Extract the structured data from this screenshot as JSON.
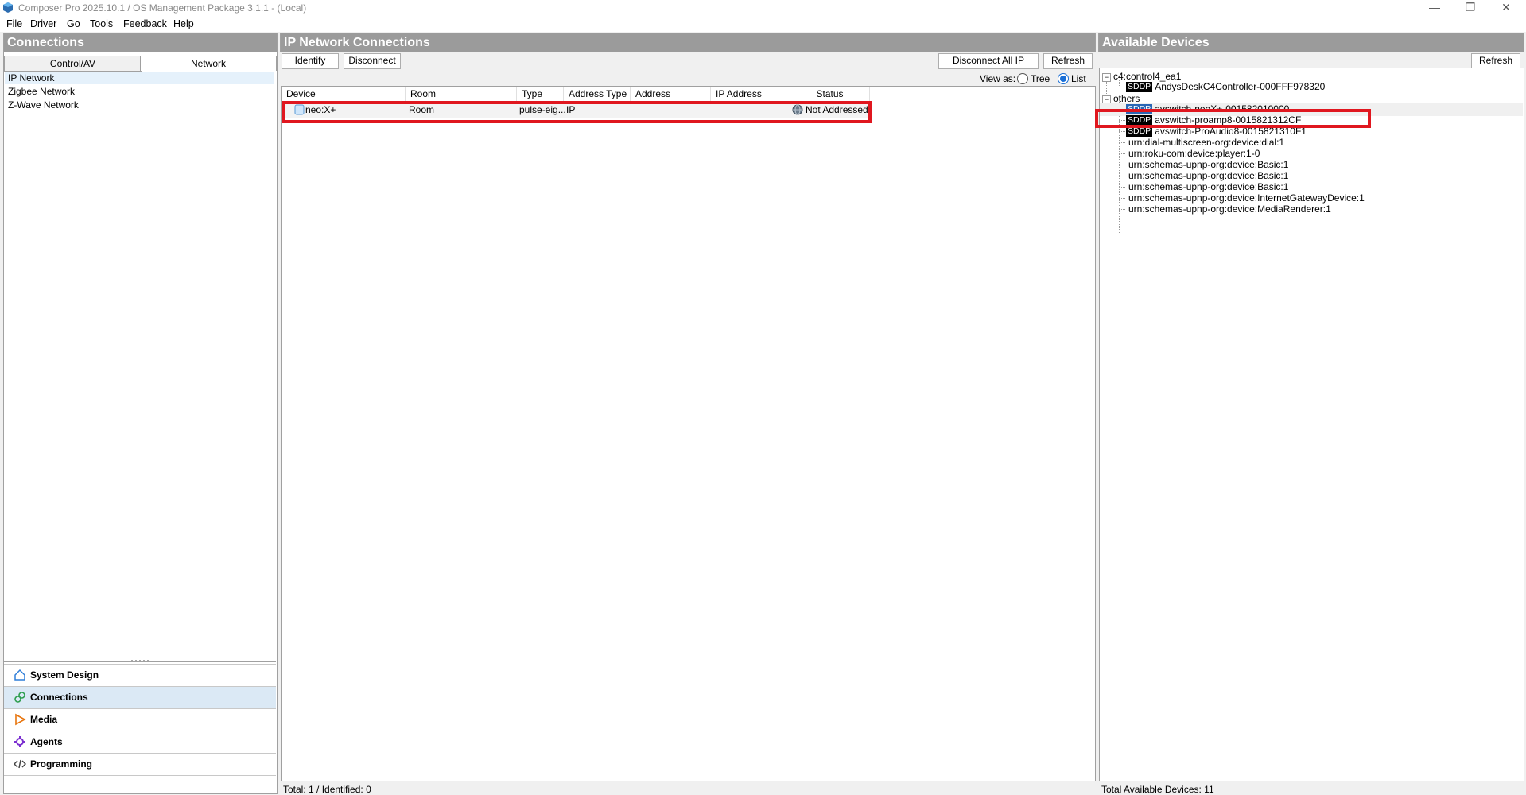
{
  "window": {
    "title": "Composer Pro 2025.10.1 / OS Management Package 3.1.1 - (Local)",
    "minimize": "—",
    "maximize": "❐",
    "close": "✕"
  },
  "menu": {
    "items": [
      "File",
      "Driver",
      "Go",
      "Tools",
      "Feedback",
      "Help"
    ]
  },
  "connections": {
    "header": "Connections",
    "tabs": [
      "Control/AV",
      "Network"
    ],
    "active_tab": "Network",
    "network_items": [
      "IP Network",
      "Zigbee Network",
      "Z-Wave Network"
    ],
    "selected_item": "IP Network",
    "splitter": "........."
  },
  "nav": {
    "items": [
      {
        "label": "System Design",
        "icon": "house-icon"
      },
      {
        "label": "Connections",
        "icon": "link-icon"
      },
      {
        "label": "Media",
        "icon": "play-icon"
      },
      {
        "label": "Agents",
        "icon": "agents-icon"
      },
      {
        "label": "Programming",
        "icon": "code-icon"
      }
    ],
    "selected": "Connections"
  },
  "ip_connections": {
    "header": "IP Network Connections",
    "buttons": {
      "identify": "Identify",
      "disconnect": "Disconnect",
      "disconnect_all": "Disconnect All IP",
      "refresh": "Refresh"
    },
    "view_as_label": "View as:",
    "view_options": [
      "Tree",
      "List"
    ],
    "view_selected": "List",
    "columns": [
      "Device",
      "Room",
      "Type",
      "Address Type",
      "Address",
      "IP Address",
      "Status"
    ],
    "rows": [
      {
        "device": "neo:X+",
        "room": "Room",
        "type": "pulse-eig...",
        "address_type": "IP",
        "address": "",
        "ip_address": "",
        "status": "Not Addressed"
      }
    ],
    "footer": "Total: 1 / Identified: 0"
  },
  "available_devices": {
    "header": "Available Devices",
    "refresh": "Refresh",
    "tree": {
      "group1": {
        "label": "c4:control4_ea1",
        "children": [
          {
            "badge": "SDDP",
            "label": "AndysDeskC4Controller-000FFF978320"
          }
        ]
      },
      "group2": {
        "label": "others",
        "children": [
          {
            "badge": "SDDP",
            "label": "avswitch-neoX+-001582010000"
          },
          {
            "badge": "SDDP",
            "label": "avswitch-proamp8-0015821312CF"
          },
          {
            "badge": "SDDP",
            "label": "avswitch-ProAudio8-0015821310F1"
          },
          {
            "badge": "",
            "label": "urn:dial-multiscreen-org:device:dial:1"
          },
          {
            "badge": "",
            "label": "urn:roku-com:device:player:1-0"
          },
          {
            "badge": "",
            "label": "urn:schemas-upnp-org:device:Basic:1"
          },
          {
            "badge": "",
            "label": "urn:schemas-upnp-org:device:Basic:1"
          },
          {
            "badge": "",
            "label": "urn:schemas-upnp-org:device:Basic:1"
          },
          {
            "badge": "",
            "label": "urn:schemas-upnp-org:device:InternetGatewayDevice:1"
          },
          {
            "badge": "",
            "label": "urn:schemas-upnp-org:device:MediaRenderer:1"
          }
        ]
      }
    },
    "selected": "avswitch-neoX+-001582010000",
    "footer": "Total Available Devices: 11"
  },
  "colors": {
    "header_bg": "#9b9b9b",
    "highlight": "#e0171f",
    "sddp_badge": "#000000",
    "selected_badge": "#2a67b5",
    "selected_row": "#e5f1fb"
  }
}
